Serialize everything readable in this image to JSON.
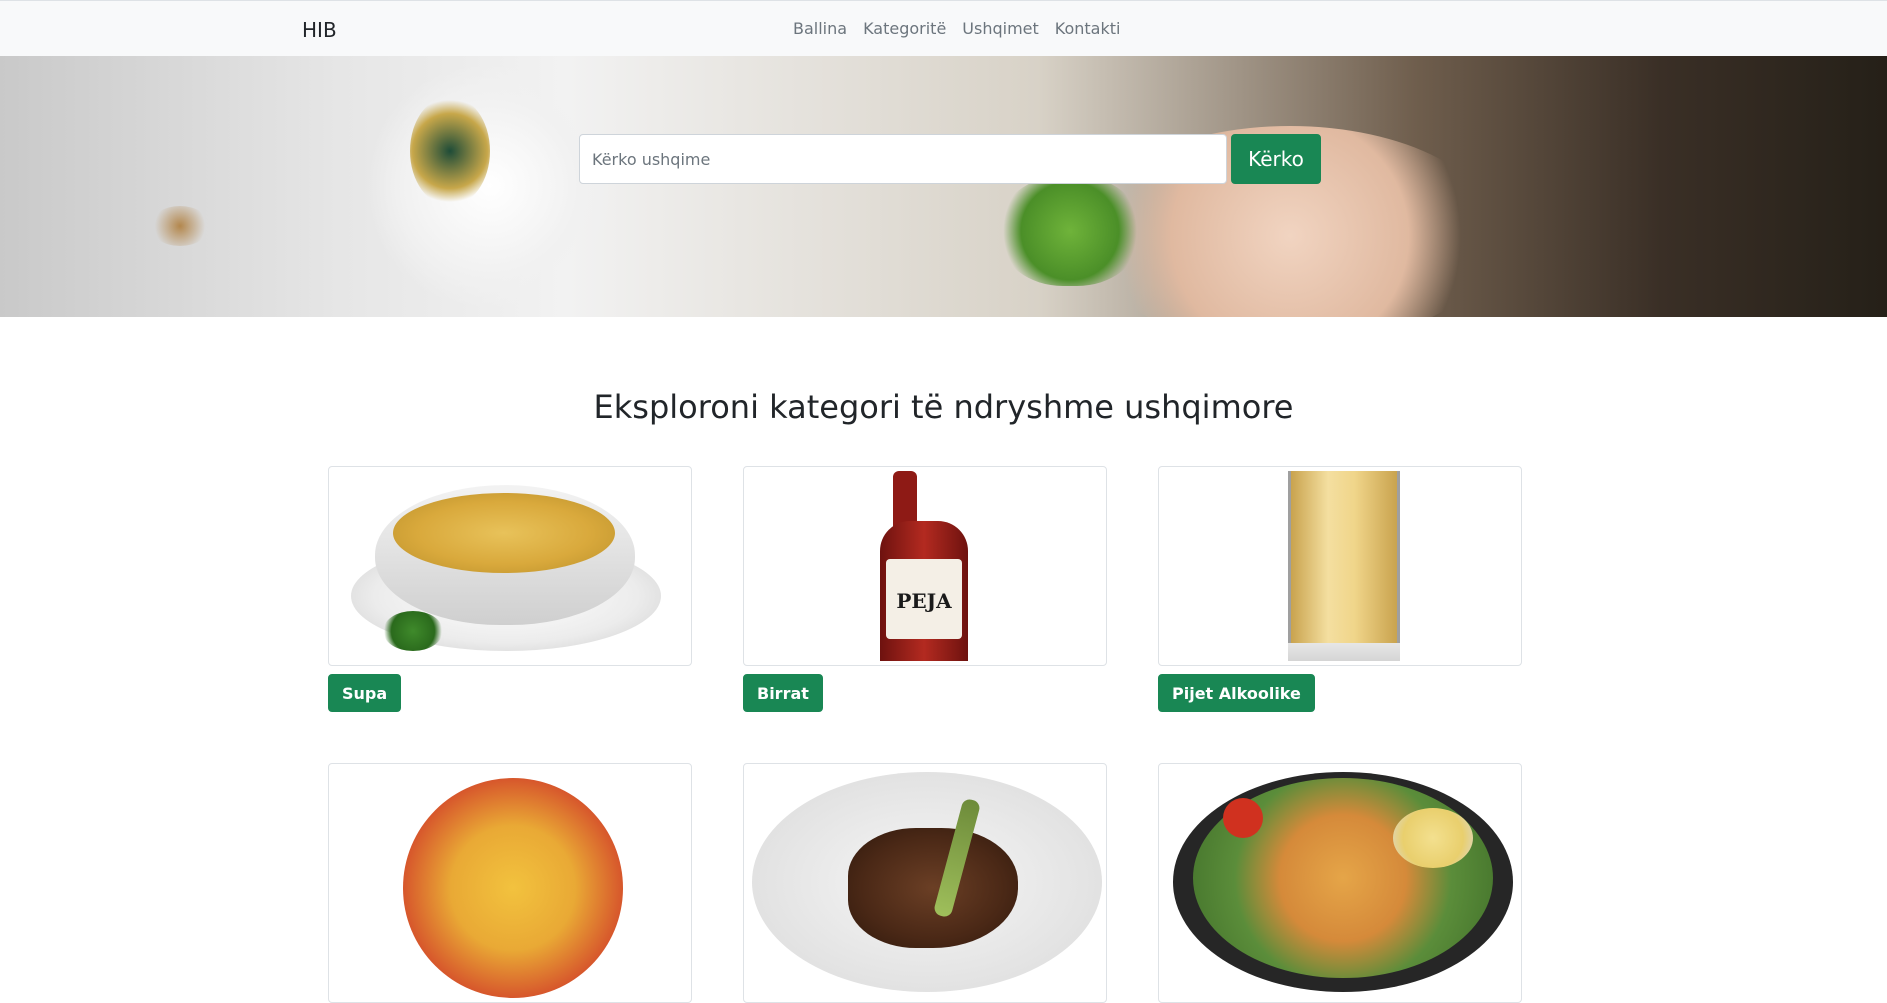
{
  "navbar": {
    "brand": "HIB",
    "links": [
      "Ballina",
      "Kategoritë",
      "Ushqimet",
      "Kontakti"
    ]
  },
  "hero": {
    "search_placeholder": "Kërko ushqime",
    "search_button": "Kërko"
  },
  "section": {
    "title": "Eksploroni kategori të ndryshme ushqimore"
  },
  "categories": [
    {
      "label": "Supa"
    },
    {
      "label": "Birrat"
    },
    {
      "label": "Pijet Alkoolike"
    }
  ],
  "images": {
    "beer_label_text": "PEJA"
  },
  "colors": {
    "accent": "#198754",
    "navbar_bg": "#f8f9fa"
  }
}
